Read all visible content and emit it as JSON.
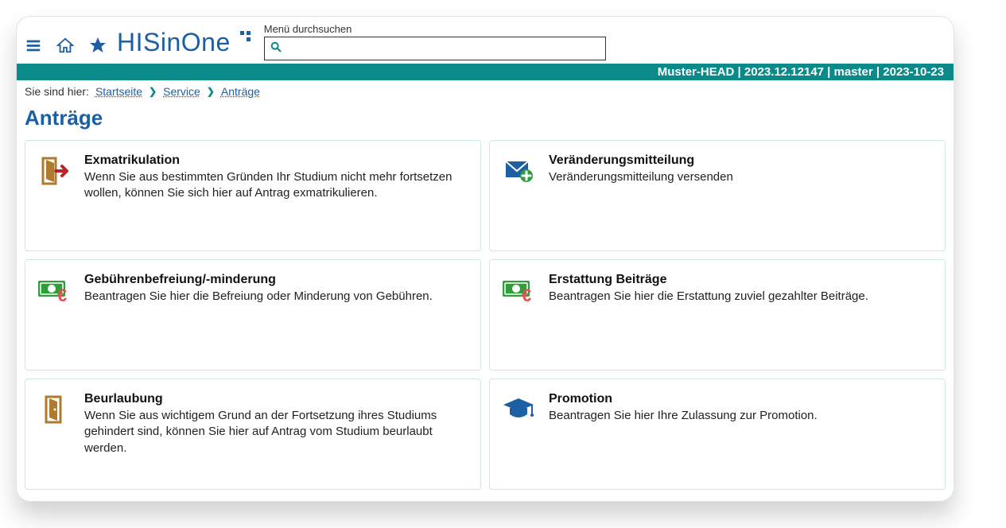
{
  "header": {
    "logo_text_1": "HIS",
    "logo_text_2": "in",
    "logo_text_3": "One",
    "search_label": "Menü durchsuchen",
    "search_placeholder": ""
  },
  "version_bar": "Muster-HEAD | 2023.12.12147 | master | 2023-10-23",
  "breadcrumb": {
    "prefix": "Sie sind hier:",
    "items": [
      "Startseite",
      "Service",
      "Anträge"
    ]
  },
  "page_title": "Anträge",
  "cards": [
    {
      "title": "Exmatrikulation",
      "desc": "Wenn Sie aus bestimmten Gründen Ihr Studium nicht mehr fortsetzen wollen, können Sie sich hier auf Antrag exmatrikulieren.",
      "icon": "door-exit"
    },
    {
      "title": "Veränderungsmitteilung",
      "desc": "Veränderungsmitteilung versenden",
      "icon": "mail-plus"
    },
    {
      "title": "Gebührenbefreiung/-minderung",
      "desc": "Beantragen Sie hier die Befreiung oder Minderung von Gebühren.",
      "icon": "money-euro"
    },
    {
      "title": "Erstattung Beiträge",
      "desc": "Beantragen Sie hier die Erstattung zuviel gezahlter Beiträge.",
      "icon": "money-euro"
    },
    {
      "title": "Beurlaubung",
      "desc": "Wenn Sie aus wichtigem Grund an der Fortsetzung ihres Studiums gehindert sind, können Sie hier auf Antrag vom Studium beurlaubt werden.",
      "icon": "door"
    },
    {
      "title": "Promotion",
      "desc": "Beantragen Sie hier Ihre Zulassung zur Promotion.",
      "icon": "graduation-cap"
    }
  ]
}
